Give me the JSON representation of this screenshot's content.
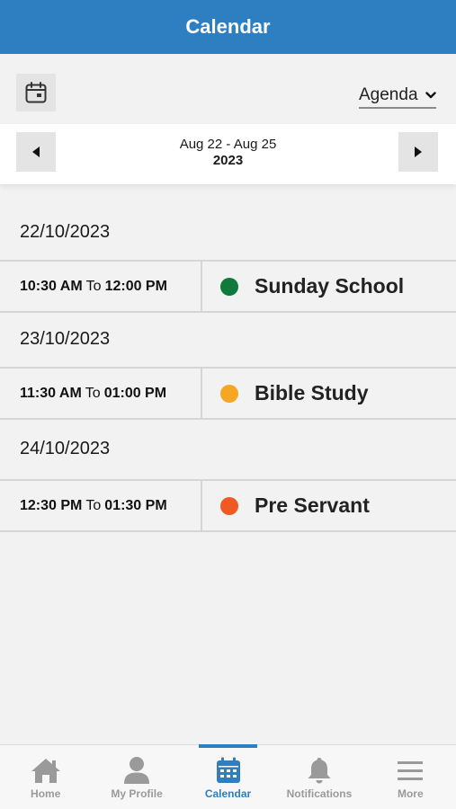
{
  "header": {
    "title": "Calendar"
  },
  "toolbar": {
    "calendar_icon": "calendar-icon",
    "view_selected": "Agenda"
  },
  "range": {
    "dates": "Aug 22 - Aug 25",
    "year": "2023"
  },
  "agenda": [
    {
      "date": "22/10/2023",
      "start": "10:30 AM",
      "to": "To",
      "end": "12:00 PM",
      "name": "Sunday School",
      "color": "#0f7a3c"
    },
    {
      "date": "23/10/2023",
      "start": "11:30 AM",
      "to": "To",
      "end": "01:00 PM",
      "name": "Bible Study",
      "color": "#f6a623"
    },
    {
      "date": "24/10/2023",
      "start": "12:30 PM",
      "to": "To",
      "end": "01:30 PM",
      "name": "Pre Servant",
      "color": "#f05a22"
    }
  ],
  "tabs": [
    {
      "label": "Home",
      "icon": "home-icon",
      "active": false
    },
    {
      "label": "My Profile",
      "icon": "person-icon",
      "active": false
    },
    {
      "label": "Calendar",
      "icon": "calendar-icon",
      "active": true
    },
    {
      "label": "Notifications",
      "icon": "bell-icon",
      "active": false
    },
    {
      "label": "More",
      "icon": "menu-icon",
      "active": false
    }
  ],
  "colors": {
    "brand": "#2d7fc1",
    "inactive_tab": "#9a9a9a"
  }
}
